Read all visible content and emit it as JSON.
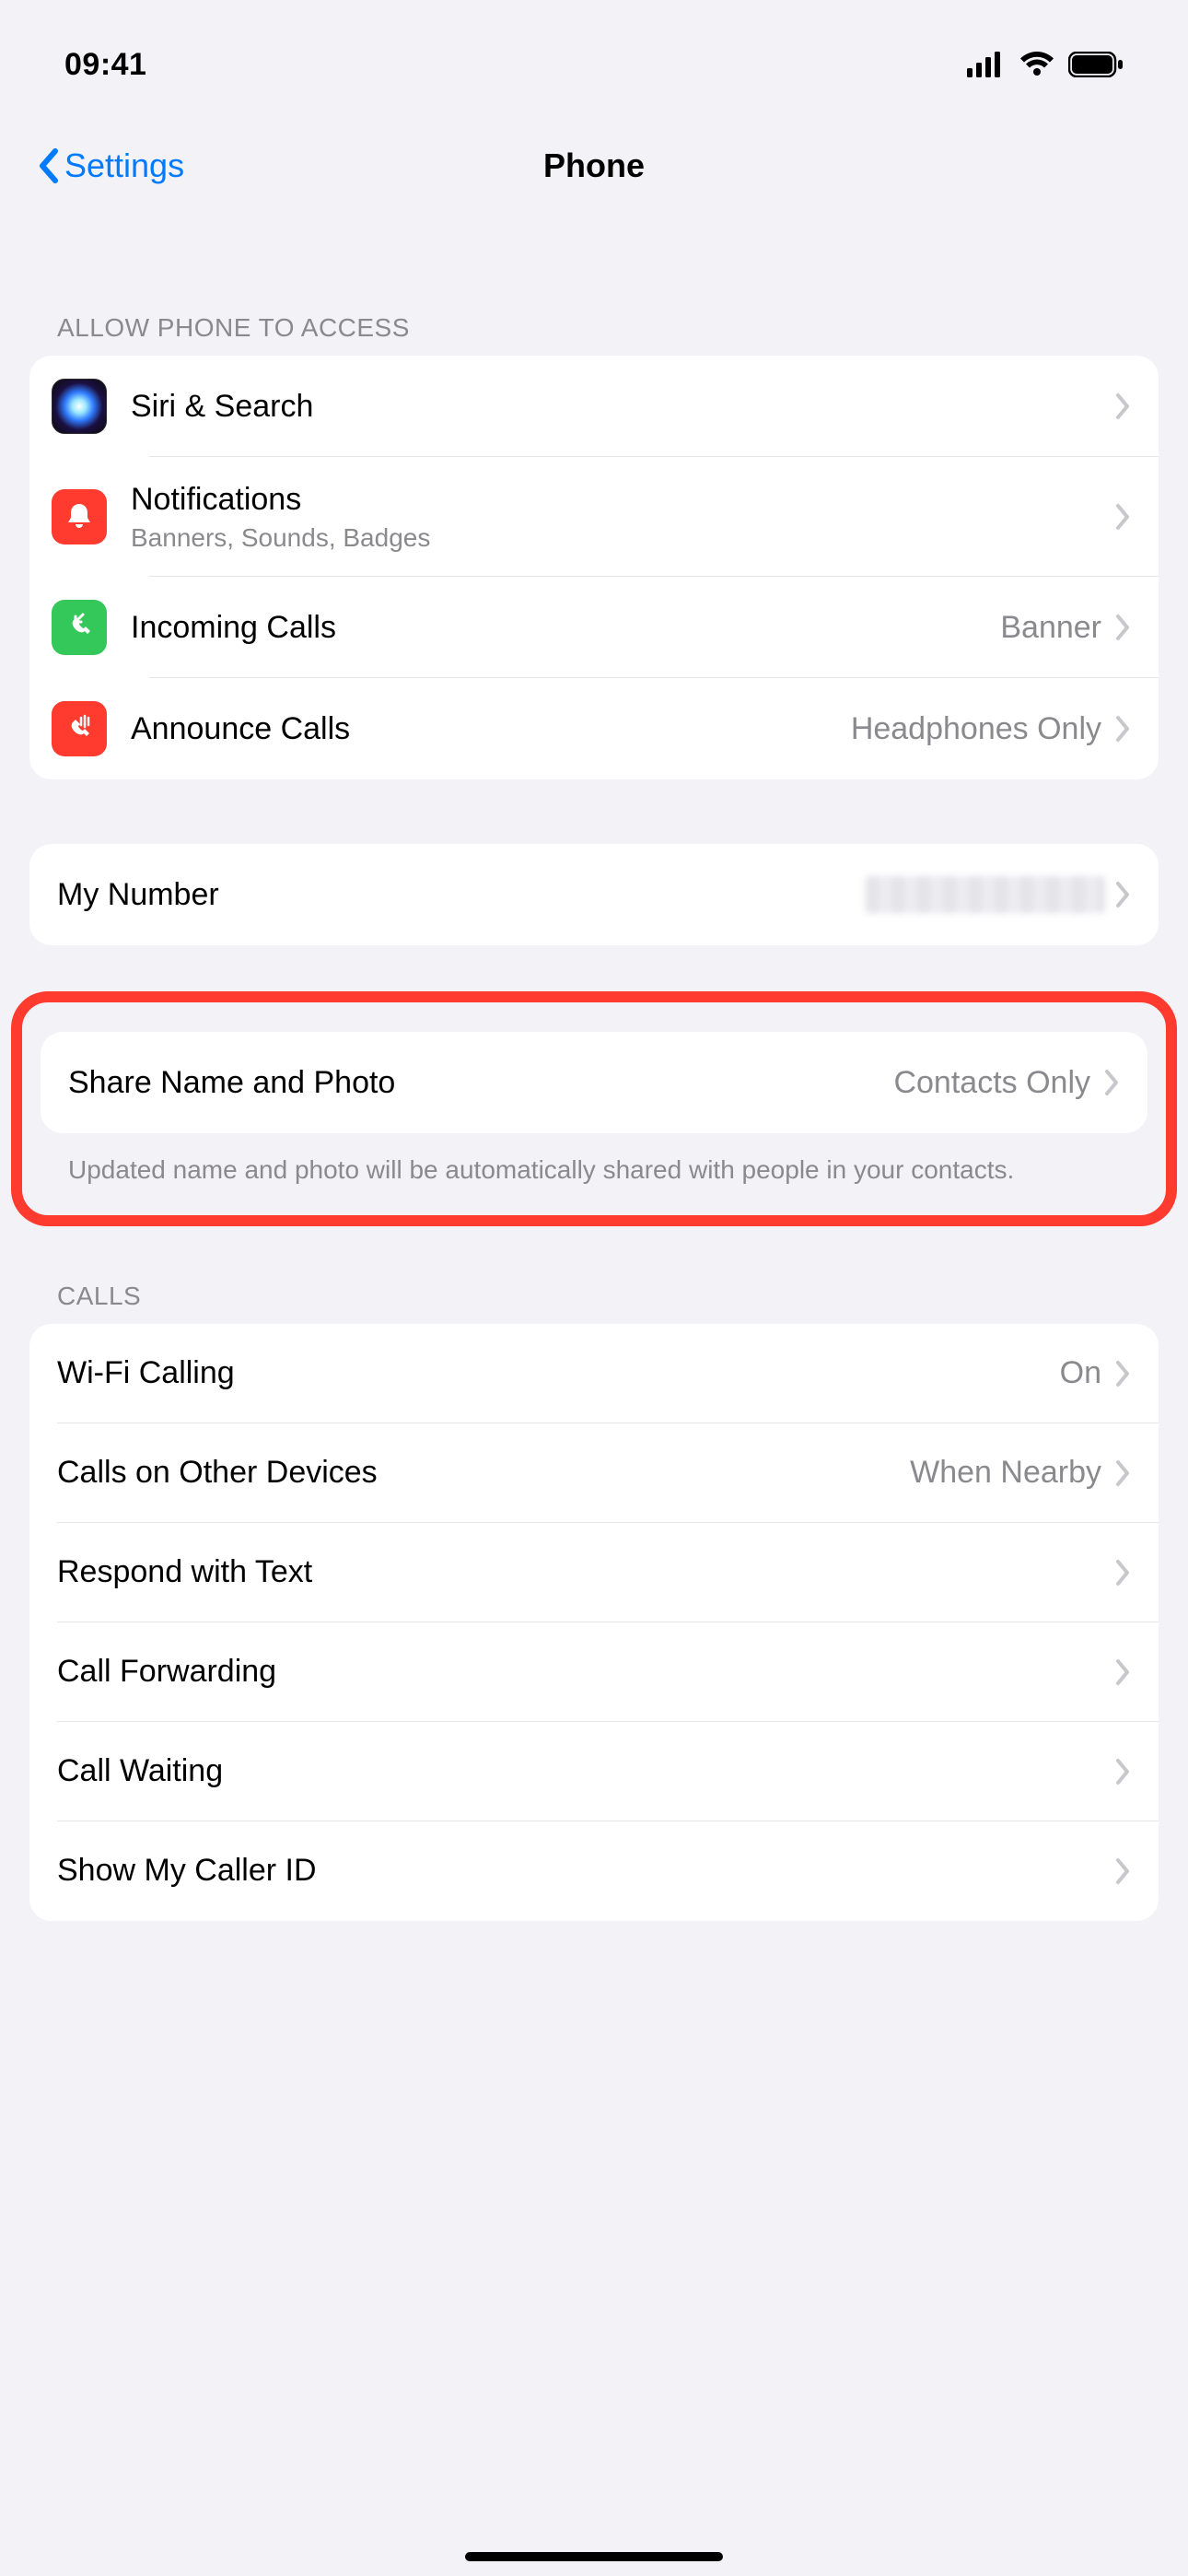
{
  "statusbar": {
    "time": "09:41"
  },
  "nav": {
    "back_label": "Settings",
    "title": "Phone"
  },
  "section_access_header": "Allow Phone to Access",
  "access": {
    "siri": {
      "title": "Siri & Search"
    },
    "notif": {
      "title": "Notifications",
      "subtitle": "Banners, Sounds, Badges"
    },
    "incoming": {
      "title": "Incoming Calls",
      "value": "Banner"
    },
    "announce": {
      "title": "Announce Calls",
      "value": "Headphones Only"
    }
  },
  "my_number": {
    "title": "My Number"
  },
  "share": {
    "title": "Share Name and Photo",
    "value": "Contacts Only",
    "footer": "Updated name and photo will be automatically shared with people in your contacts."
  },
  "section_calls_header": "Calls",
  "calls": {
    "wifi": {
      "title": "Wi-Fi Calling",
      "value": "On"
    },
    "other": {
      "title": "Calls on Other Devices",
      "value": "When Nearby"
    },
    "respond": {
      "title": "Respond with Text"
    },
    "forward": {
      "title": "Call Forwarding"
    },
    "waiting": {
      "title": "Call Waiting"
    },
    "caller": {
      "title": "Show My Caller ID"
    }
  }
}
